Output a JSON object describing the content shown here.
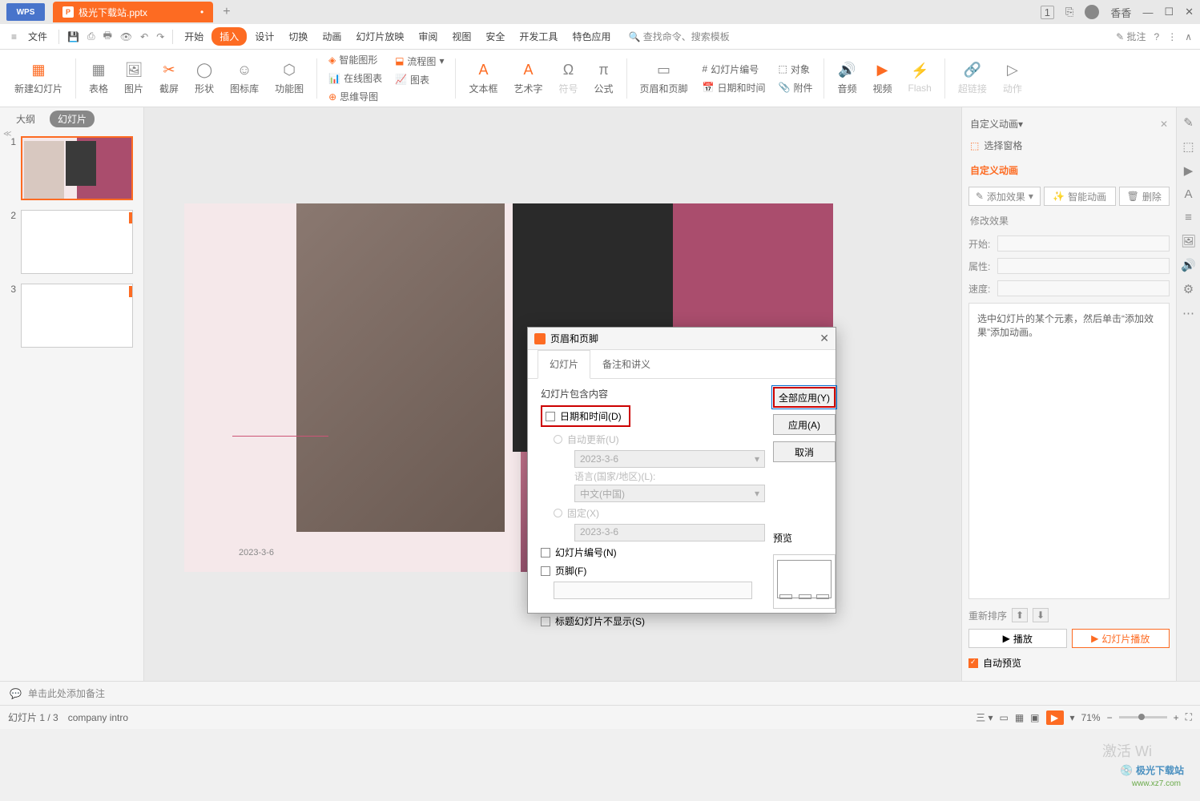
{
  "title": {
    "wps": "WPS",
    "file": "极光下载站.pptx",
    "user": "香香"
  },
  "menu": {
    "file": "文件",
    "start": "开始",
    "insert": "插入",
    "design": "设计",
    "transition": "切换",
    "animation": "动画",
    "slideshow": "幻灯片放映",
    "review": "审阅",
    "view": "视图",
    "security": "安全",
    "dev": "开发工具",
    "special": "特色应用",
    "search": "查找命令、搜索模板",
    "comment": "批注"
  },
  "ribbon": {
    "newslide": "新建幻灯片",
    "table": "表格",
    "picture": "图片",
    "screenshot": "截屏",
    "shape": "形状",
    "iconlib": "图标库",
    "funcpic": "功能图",
    "smartart": "智能图形",
    "onlinechart": "在线图表",
    "flowchart": "流程图",
    "mindmap": "思维导图",
    "chart": "图表",
    "textbox": "文本框",
    "wordart": "艺术字",
    "symbol": "符号",
    "formula": "公式",
    "headerfooter": "页眉和页脚",
    "slidenum": "幻灯片编号",
    "datetime": "日期和时间",
    "object": "对象",
    "attachment": "附件",
    "audio": "音频",
    "video": "视频",
    "flash": "Flash",
    "hyperlink": "超链接",
    "action": "动作"
  },
  "thumb": {
    "outline": "大纲",
    "slide": "幻灯片"
  },
  "slide": {
    "date": "2023-3-6"
  },
  "dialog": {
    "title": "页眉和页脚",
    "tab1": "幻灯片",
    "tab2": "备注和讲义",
    "content_label": "幻灯片包含内容",
    "datetime": "日期和时间(D)",
    "autoupdate": "自动更新(U)",
    "date_value": "2023-3-6",
    "lang_label": "语言(国家/地区)(L):",
    "lang_value": "中文(中国)",
    "fixed": "固定(X)",
    "fixed_value": "2023-3-6",
    "slidenum": "幻灯片编号(N)",
    "footer": "页脚(F)",
    "noshow": "标题幻灯片不显示(S)",
    "apply_all": "全部应用(Y)",
    "apply": "应用(A)",
    "cancel": "取消",
    "preview": "预览"
  },
  "side": {
    "title": "自定义动画",
    "selpane": "选择窗格",
    "custom": "自定义动画",
    "addfx": "添加效果",
    "smartanim": "智能动画",
    "delete": "删除",
    "modify": "修改效果",
    "start": "开始:",
    "prop": "属性:",
    "speed": "速度:",
    "hint": "选中幻灯片的某个元素，然后单击“添加效果”添加动画。",
    "reorder": "重新排序",
    "play": "播放",
    "slideplay": "幻灯片播放",
    "autoprev": "自动预览"
  },
  "notes": {
    "placeholder": "单击此处添加备注"
  },
  "status": {
    "slide": "幻灯片 1 / 3",
    "theme": "company intro",
    "zoom": "71%",
    "activate": "激活 Wi"
  },
  "watermark": {
    "brand": "极光下载站",
    "url": "www.xz7.com"
  }
}
